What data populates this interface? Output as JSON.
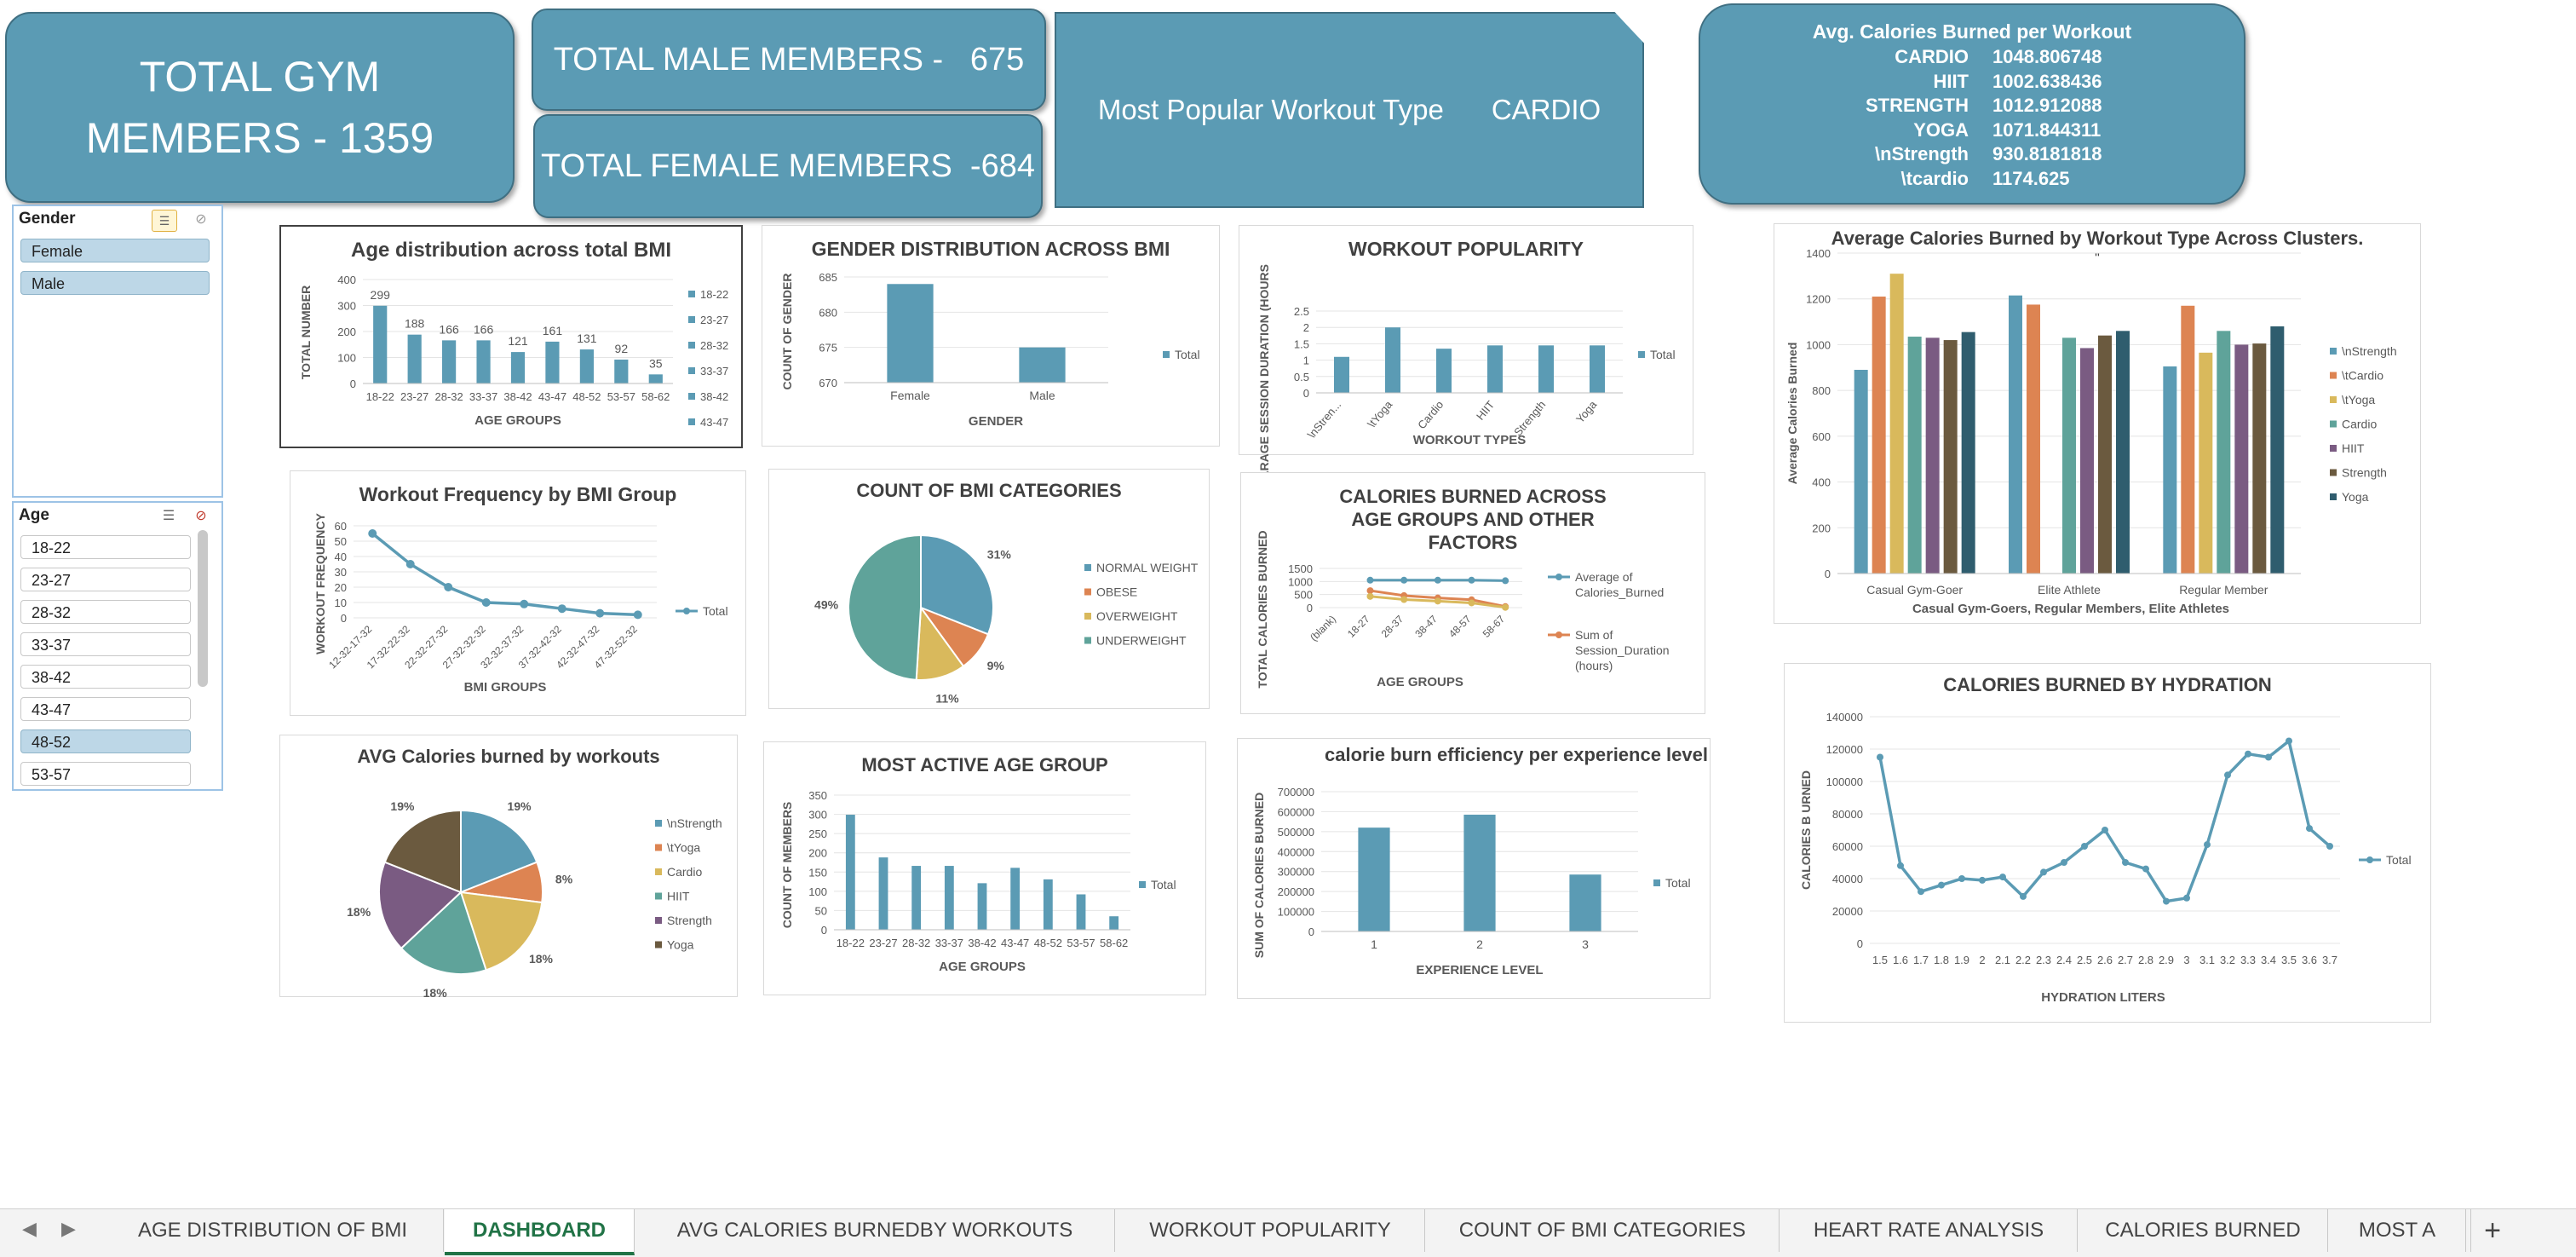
{
  "kpis": {
    "total_members": "TOTAL GYM MEMBERS - 1359",
    "total_male": "TOTAL MALE MEMBERS -   675",
    "total_female": "TOTAL FEMALE MEMBERS  -684",
    "popular_label": "Most Popular Workout Type",
    "popular_value": "CARDIO",
    "avg_title": "Avg. Calories Burned per Workout",
    "avg_rows": [
      {
        "name": "CARDIO",
        "value": "1048.806748"
      },
      {
        "name": "HIIT",
        "value": "1002.638436"
      },
      {
        "name": "STRENGTH",
        "value": "1012.912088"
      },
      {
        "name": "YOGA",
        "value": "1071.844311"
      },
      {
        "name": "\\nStrength",
        "value": "930.8181818"
      },
      {
        "name": "\\tcardio",
        "value": "1174.625"
      }
    ]
  },
  "slicers": {
    "gender": {
      "title": "Gender",
      "items": [
        "Female",
        "Male"
      ],
      "selected": [
        "Female",
        "Male"
      ]
    },
    "age": {
      "title": "Age",
      "items": [
        "18-22",
        "23-27",
        "28-32",
        "33-37",
        "38-42",
        "43-47",
        "48-52",
        "53-57"
      ],
      "selected": [
        "48-52"
      ]
    }
  },
  "colors": {
    "accent": "#5b9bb4",
    "orange": "#dd8452",
    "gold": "#d9b95c",
    "teal": "#5fa39a",
    "purple": "#7a5b82",
    "brown": "#6b5a3f",
    "navy": "#2f5d6e",
    "excel_green": "#217346"
  },
  "tabs": {
    "items": [
      "AGE DISTRIBUTION OF BMI",
      "DASHBOARD",
      "AVG CALORIES BURNEDBY WORKOUTS",
      "WORKOUT POPULARITY",
      "COUNT OF BMI CATEGORIES",
      "HEART RATE ANALYSIS",
      "CALORIES BURNED",
      "MOST A"
    ],
    "active": "DASHBOARD",
    "add": "+"
  },
  "chart_data": [
    {
      "id": "age_dist",
      "type": "bar",
      "title": "Age distribution across total BMI",
      "xlabel": "AGE GROUPS",
      "ylabel": "TOTAL NUMBER",
      "categories": [
        "18-22",
        "23-27",
        "28-32",
        "33-37",
        "38-42",
        "43-47",
        "48-52",
        "53-57",
        "58-62"
      ],
      "values": [
        299,
        188,
        166,
        166,
        121,
        161,
        131,
        92,
        35
      ],
      "yticks": [
        0,
        100,
        200,
        300,
        400
      ],
      "ylim": [
        0,
        400
      ],
      "legend": [
        "18-22",
        "23-27",
        "28-32",
        "33-37",
        "38-42",
        "43-47"
      ]
    },
    {
      "id": "gender_bmi",
      "type": "bar",
      "title": "GENDER DISTRIBUTION ACROSS BMI",
      "xlabel": "GENDER",
      "ylabel": "COUNT OF GENDER",
      "categories": [
        "Female",
        "Male"
      ],
      "values": [
        684,
        675
      ],
      "yticks": [
        670,
        675,
        680,
        685
      ],
      "ylim": [
        670,
        685
      ],
      "legend": [
        "Total"
      ]
    },
    {
      "id": "workout_pop",
      "type": "bar",
      "title": "WORKOUT POPULARITY",
      "xlabel": "WORKOUT TYPES",
      "ylabel": "AVARAGE SESSION DURATION (HOURS",
      "categories": [
        "\\nStren...",
        "\\tYoga",
        "Cardio",
        "HIIT",
        "Strength",
        "Yoga"
      ],
      "values": [
        1.1,
        2.0,
        1.35,
        1.45,
        1.45,
        1.45
      ],
      "yticks": [
        0,
        0.5,
        1,
        1.5,
        2,
        2.5
      ],
      "ylim": [
        0,
        2.5
      ],
      "legend": [
        "Total"
      ]
    },
    {
      "id": "cal_clusters",
      "type": "bar",
      "title": "Average Calories Burned by Workout Type Across Clusters.",
      "subtitle": "\"",
      "xlabel": "Casual Gym-Goers, Regular Members, Elite Athletes",
      "ylabel": "Average Calories Burned",
      "categories": [
        "Casual Gym-Goer",
        "Elite Athlete",
        "Regular Member"
      ],
      "series": [
        {
          "name": "\\nStrength",
          "values": [
            890,
            1215,
            905
          ]
        },
        {
          "name": "\\tCardio",
          "values": [
            1210,
            1175,
            1170
          ]
        },
        {
          "name": "\\tYoga",
          "values": [
            1310,
            null,
            965
          ]
        },
        {
          "name": "Cardio",
          "values": [
            1035,
            1030,
            1060
          ]
        },
        {
          "name": "HIIT",
          "values": [
            1030,
            985,
            1000
          ]
        },
        {
          "name": "Strength",
          "values": [
            1020,
            1040,
            1005
          ]
        },
        {
          "name": "Yoga",
          "values": [
            1055,
            1060,
            1080
          ]
        }
      ],
      "yticks": [
        0,
        200,
        400,
        600,
        800,
        1000,
        1200,
        1400
      ],
      "ylim": [
        0,
        1400
      ]
    },
    {
      "id": "freq_bmi",
      "type": "line",
      "title": "Workout Frequency by BMI Group",
      "xlabel": "BMI GROUPS",
      "ylabel": "WORKOUT FREQUENCY",
      "categories": [
        "12-32-17-32",
        "17-32-22-32",
        "22-32-27-32",
        "27-32-32-32",
        "32-32-37-32",
        "37-32-42-32",
        "42-32-47-32",
        "47-32-52-32"
      ],
      "values": [
        55,
        35,
        20,
        10,
        9,
        6,
        3,
        2
      ],
      "yticks": [
        0,
        10,
        20,
        30,
        40,
        50,
        60
      ],
      "ylim": [
        0,
        60
      ],
      "legend": [
        "Total"
      ]
    },
    {
      "id": "bmi_cat",
      "type": "pie",
      "title": "COUNT OF BMI CATEGORIES",
      "labels": [
        "NORMAL WEIGHT",
        "OBESE",
        "OVERWEIGHT",
        "UNDERWEIGHT"
      ],
      "values": [
        31,
        9,
        11,
        49
      ],
      "value_labels": [
        "31%",
        "9%",
        "11%",
        "49%"
      ]
    },
    {
      "id": "cal_age",
      "type": "line",
      "title": "CALORIES BURNED ACROSS AGE GROUPS AND OTHER  FACTORS",
      "xlabel": "AGE GROUPS",
      "ylabel": "TOTAL CALORIES BURNED",
      "categories": [
        "(blank)",
        "18-27",
        "28-37",
        "38-47",
        "48-57",
        "58-67"
      ],
      "series": [
        {
          "name": "Average of Calories_Burned",
          "values": [
            null,
            1050,
            1050,
            1050,
            1050,
            1030
          ]
        },
        {
          "name": "Sum of Session_Duration (hours)",
          "values": [
            null,
            650,
            460,
            370,
            300,
            40
          ]
        },
        {
          "name": "",
          "values": [
            null,
            430,
            310,
            250,
            180,
            10
          ]
        }
      ],
      "yticks": [
        0,
        500,
        1000,
        1500
      ],
      "ylim": [
        0,
        1500
      ]
    },
    {
      "id": "cal_hydration",
      "type": "line",
      "title": "CALORIES BURNED BY HYDRATION",
      "xlabel": "HYDRATION LITERS",
      "ylabel": "CALORIES B URNED",
      "categories": [
        "1.5",
        "1.6",
        "1.7",
        "1.8",
        "1.9",
        "2",
        "2.1",
        "2.2",
        "2.3",
        "2.4",
        "2.5",
        "2.6",
        "2.7",
        "2.8",
        "2.9",
        "3",
        "3.1",
        "3.2",
        "3.3",
        "3.4",
        "3.5",
        "3.6",
        "3.7"
      ],
      "values": [
        115000,
        48000,
        32000,
        36000,
        40000,
        39000,
        41000,
        29000,
        44000,
        50000,
        60000,
        70000,
        50000,
        46000,
        26000,
        28000,
        61000,
        104000,
        117000,
        115000,
        125000,
        71000,
        60000
      ],
      "yticks": [
        0,
        20000,
        40000,
        60000,
        80000,
        100000,
        120000,
        140000
      ],
      "ylim": [
        0,
        140000
      ],
      "legend": [
        "Total"
      ]
    },
    {
      "id": "avg_workouts",
      "type": "pie",
      "title": "AVG Calories burned by workouts",
      "labels": [
        "\\nStrength",
        "\\tYoga",
        "Cardio",
        "HIIT",
        "Strength",
        "Yoga"
      ],
      "values": [
        19,
        8,
        18,
        18,
        18,
        19
      ],
      "value_labels": [
        "19%",
        "8%",
        "18%",
        "18%",
        "18%",
        "19%"
      ]
    },
    {
      "id": "active_age",
      "type": "bar",
      "title": "MOST ACTIVE AGE GROUP",
      "xlabel": "AGE GROUPS",
      "ylabel": "COUNT OF MEMBERS",
      "categories": [
        "18-22",
        "23-27",
        "28-32",
        "33-37",
        "38-42",
        "43-47",
        "48-52",
        "53-57",
        "58-62"
      ],
      "values": [
        299,
        188,
        166,
        166,
        121,
        161,
        131,
        92,
        35
      ],
      "yticks": [
        0,
        50,
        100,
        150,
        200,
        250,
        300,
        350
      ],
      "ylim": [
        0,
        350
      ],
      "legend": [
        "Total"
      ]
    },
    {
      "id": "efficiency",
      "type": "bar",
      "title": "calorie burn efficiency per experience level",
      "xlabel": "EXPERIENCE LEVEL",
      "ylabel": "SUM OF CALORIES BURNED",
      "categories": [
        "1",
        "2",
        "3"
      ],
      "values": [
        520000,
        585000,
        285000
      ],
      "yticks": [
        0,
        100000,
        200000,
        300000,
        400000,
        500000,
        600000,
        700000
      ],
      "ylim": [
        0,
        700000
      ],
      "legend": [
        "Total"
      ]
    }
  ]
}
